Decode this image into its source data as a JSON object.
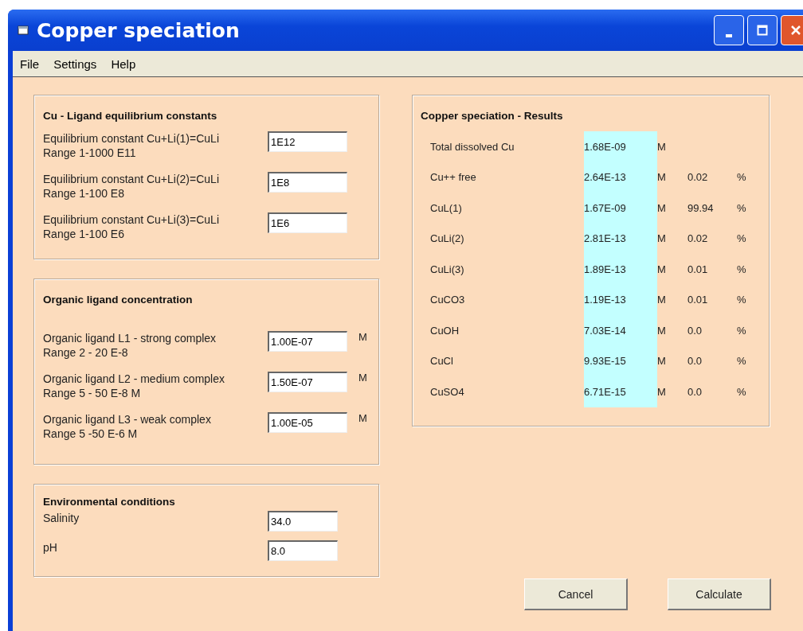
{
  "window": {
    "title": "Copper speciation"
  },
  "menu": [
    "File",
    "Settings",
    "Help"
  ],
  "constants": {
    "title": "Cu - Ligand equilibrium constants",
    "rows": [
      {
        "label": "Equilibrium constant Cu+Li(1)=CuLi Range 1-1000  E11",
        "value": "1E12"
      },
      {
        "label": "Equilibrium constant Cu+Li(2)=CuLi Range 1-100  E8",
        "value": "1E8"
      },
      {
        "label": "Equilibrium constant Cu+Li(3)=CuLi Range 1-100  E6",
        "value": "1E6"
      }
    ]
  },
  "ligands": {
    "title": "Organic ligand concentration",
    "rows": [
      {
        "label": "Organic ligand L1 - strong complex Range 2 - 20 E-8",
        "value": "1.00E-07",
        "unit": "M"
      },
      {
        "label": "Organic ligand L2 - medium complex Range 5 - 50 E-8 M",
        "value": "1.50E-07",
        "unit": "M"
      },
      {
        "label": "Organic ligand L3 - weak complex Range 5 -50 E-6 M",
        "value": "1.00E-05",
        "unit": "M"
      }
    ]
  },
  "environment": {
    "title": "Environmental conditions",
    "rows": [
      {
        "label": "Salinity",
        "value": "34.0"
      },
      {
        "label": "pH",
        "value": "8.0"
      }
    ]
  },
  "results": {
    "title": "Copper speciation - Results",
    "rows": [
      {
        "species": "Total dissolved Cu",
        "concentration": "1.68E-09",
        "unit": "M"
      },
      {
        "species": "Cu++ free",
        "concentration": "2.64E-13",
        "unit": "M",
        "percent": "0.02",
        "percent_unit": "%"
      },
      {
        "species": "CuL(1)",
        "concentration": "1.67E-09",
        "unit": "M",
        "percent": "99.94",
        "percent_unit": "%"
      },
      {
        "species": "CuLi(2)",
        "concentration": "2.81E-13",
        "unit": "M",
        "percent": "0.02",
        "percent_unit": "%"
      },
      {
        "species": "CuLi(3)",
        "concentration": "1.89E-13",
        "unit": "M",
        "percent": "0.01",
        "percent_unit": "%"
      },
      {
        "species": "CuCO3",
        "concentration": "1.19E-13",
        "unit": "M",
        "percent": "0.01",
        "percent_unit": "%"
      },
      {
        "species": "CuOH",
        "concentration": "7.03E-14",
        "unit": "M",
        "percent": "0.0",
        "percent_unit": "%"
      },
      {
        "species": "CuCl",
        "concentration": "9.93E-15",
        "unit": "M",
        "percent": "0.0",
        "percent_unit": "%"
      },
      {
        "species": "CuSO4",
        "concentration": "6.71E-15",
        "unit": "M",
        "percent": "0.0",
        "percent_unit": "%"
      }
    ]
  },
  "buttons": [
    "Cancel",
    "Calculate"
  ]
}
